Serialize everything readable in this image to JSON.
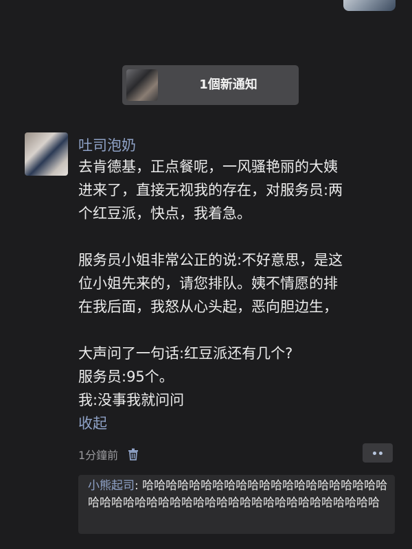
{
  "notification": {
    "label": "1個新通知"
  },
  "post": {
    "username": "吐司泡奶",
    "paragraphs": [
      "去肯德基，正点餐呢，一风骚艳丽的大姨\n进来了，直接无视我的存在，对服务员:两\n个红豆派，快点，我着急。",
      "服务员小姐非常公正的说:不好意思，是这\n位小姐先来的，请您排队。姨不情愿的排\n在我后面，我怒从心头起，恶向胆边生，",
      "大声问了一句话:红豆派还有几个?\n服务员:95个。\n我:没事我就问问"
    ],
    "collapse_label": "收起",
    "timestamp": "1分鐘前"
  },
  "comment": {
    "user": "小熊起司",
    "separator": ": ",
    "text": "哈哈哈哈哈哈哈哈哈哈哈哈哈哈哈哈哈哈哈哈哈哈哈哈哈哈哈哈哈哈哈哈哈哈哈哈哈哈哈哈哈哈哈哈哈哈"
  },
  "icons": {
    "trash": "trash-icon",
    "more": "more-dots-icon"
  },
  "colors": {
    "background": "#1c1c1e",
    "link": "#8fa2c7",
    "notification_bg": "#48484b",
    "comment_bg": "#2c2c2e"
  }
}
